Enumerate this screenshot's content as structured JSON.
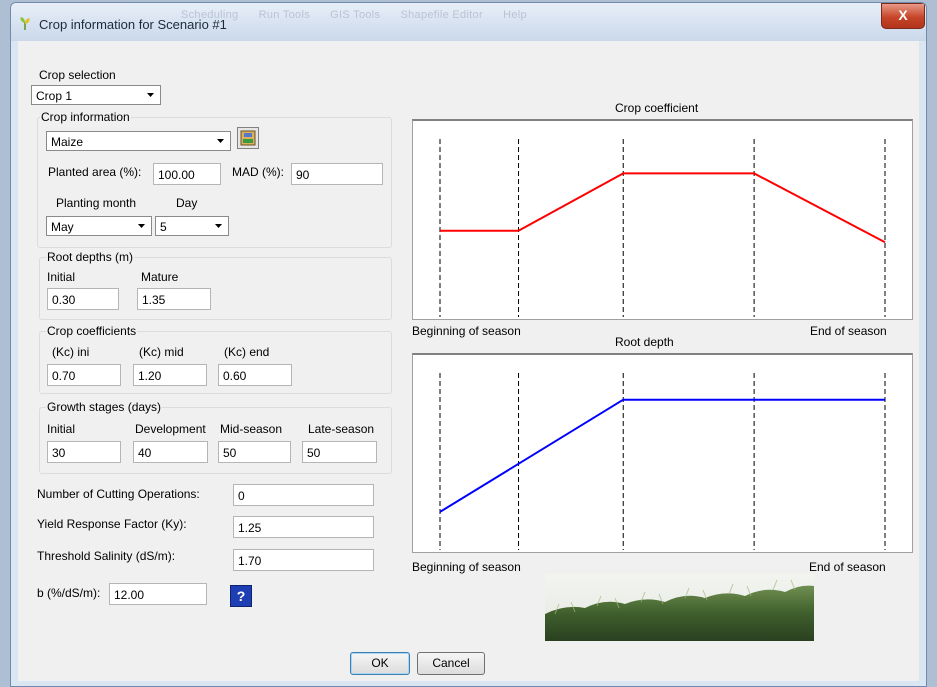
{
  "window": {
    "title": "Crop information for Scenario #1",
    "close_symbol": "X"
  },
  "background_menu": {
    "items": [
      "Scheduling",
      "Run Tools",
      "GIS Tools",
      "Shapefile Editor",
      "Help"
    ]
  },
  "crop_selection": {
    "label": "Crop selection",
    "value": "Crop 1"
  },
  "crop_information": {
    "legend": "Crop information",
    "crop": "Maize",
    "planted_area_label": "Planted area (%):",
    "planted_area": "100.00",
    "mad_label": "MAD (%):",
    "mad": "90",
    "planting_month_label": "Planting month",
    "planting_month": "May",
    "day_label": "Day",
    "day": "5"
  },
  "root_depths": {
    "legend": "Root depths (m)",
    "initial_label": "Initial",
    "initial": "0.30",
    "mature_label": "Mature",
    "mature": "1.35"
  },
  "crop_coefficients": {
    "legend": "Crop coefficients",
    "kc_ini_label": "(Kc) ini",
    "kc_ini": "0.70",
    "kc_mid_label": "(Kc) mid",
    "kc_mid": "1.20",
    "kc_end_label": "(Kc) end",
    "kc_end": "0.60"
  },
  "growth_stages": {
    "legend": "Growth stages (days)",
    "initial_label": "Initial",
    "initial": "30",
    "development_label": "Development",
    "development": "40",
    "mid_label": "Mid-season",
    "mid": "50",
    "late_label": "Late-season",
    "late": "50"
  },
  "extra": {
    "cutting_label": "Number of Cutting Operations:",
    "cutting": "0",
    "ky_label": "Yield Response Factor (Ky):",
    "ky": "1.25",
    "salinity_label": "Threshold Salinity (dS/m):",
    "salinity": "1.70",
    "b_label": "b (%/dS/m):",
    "b": "12.00",
    "help_symbol": "?"
  },
  "charts": {
    "kc": {
      "title": "Crop coefficient",
      "left_label": "Beginning of season",
      "right_label": "End of season",
      "color": "#ff0000"
    },
    "root": {
      "title": "Root depth",
      "left_label": "Beginning of season",
      "right_label": "End of season",
      "color": "#0000ff"
    }
  },
  "chart_data": [
    {
      "type": "line",
      "title": "Crop coefficient",
      "xlabel": "",
      "ylabel": "",
      "x": [
        0,
        30,
        70,
        120,
        170
      ],
      "stage_boundaries_days": [
        0,
        30,
        70,
        120,
        170
      ],
      "series": [
        {
          "values": [
            0.7,
            0.7,
            1.2,
            1.2,
            0.6
          ]
        }
      ],
      "ylim": [
        0,
        1.5
      ],
      "grid": false
    },
    {
      "type": "line",
      "title": "Root depth",
      "xlabel": "",
      "ylabel": "",
      "x": [
        0,
        70,
        170
      ],
      "stage_boundaries_days": [
        0,
        30,
        70,
        120,
        170
      ],
      "series": [
        {
          "values": [
            0.3,
            1.35,
            1.35
          ]
        }
      ],
      "ylim": [
        0,
        1.6
      ],
      "grid": false
    }
  ],
  "buttons": {
    "ok": "OK",
    "cancel": "Cancel"
  }
}
